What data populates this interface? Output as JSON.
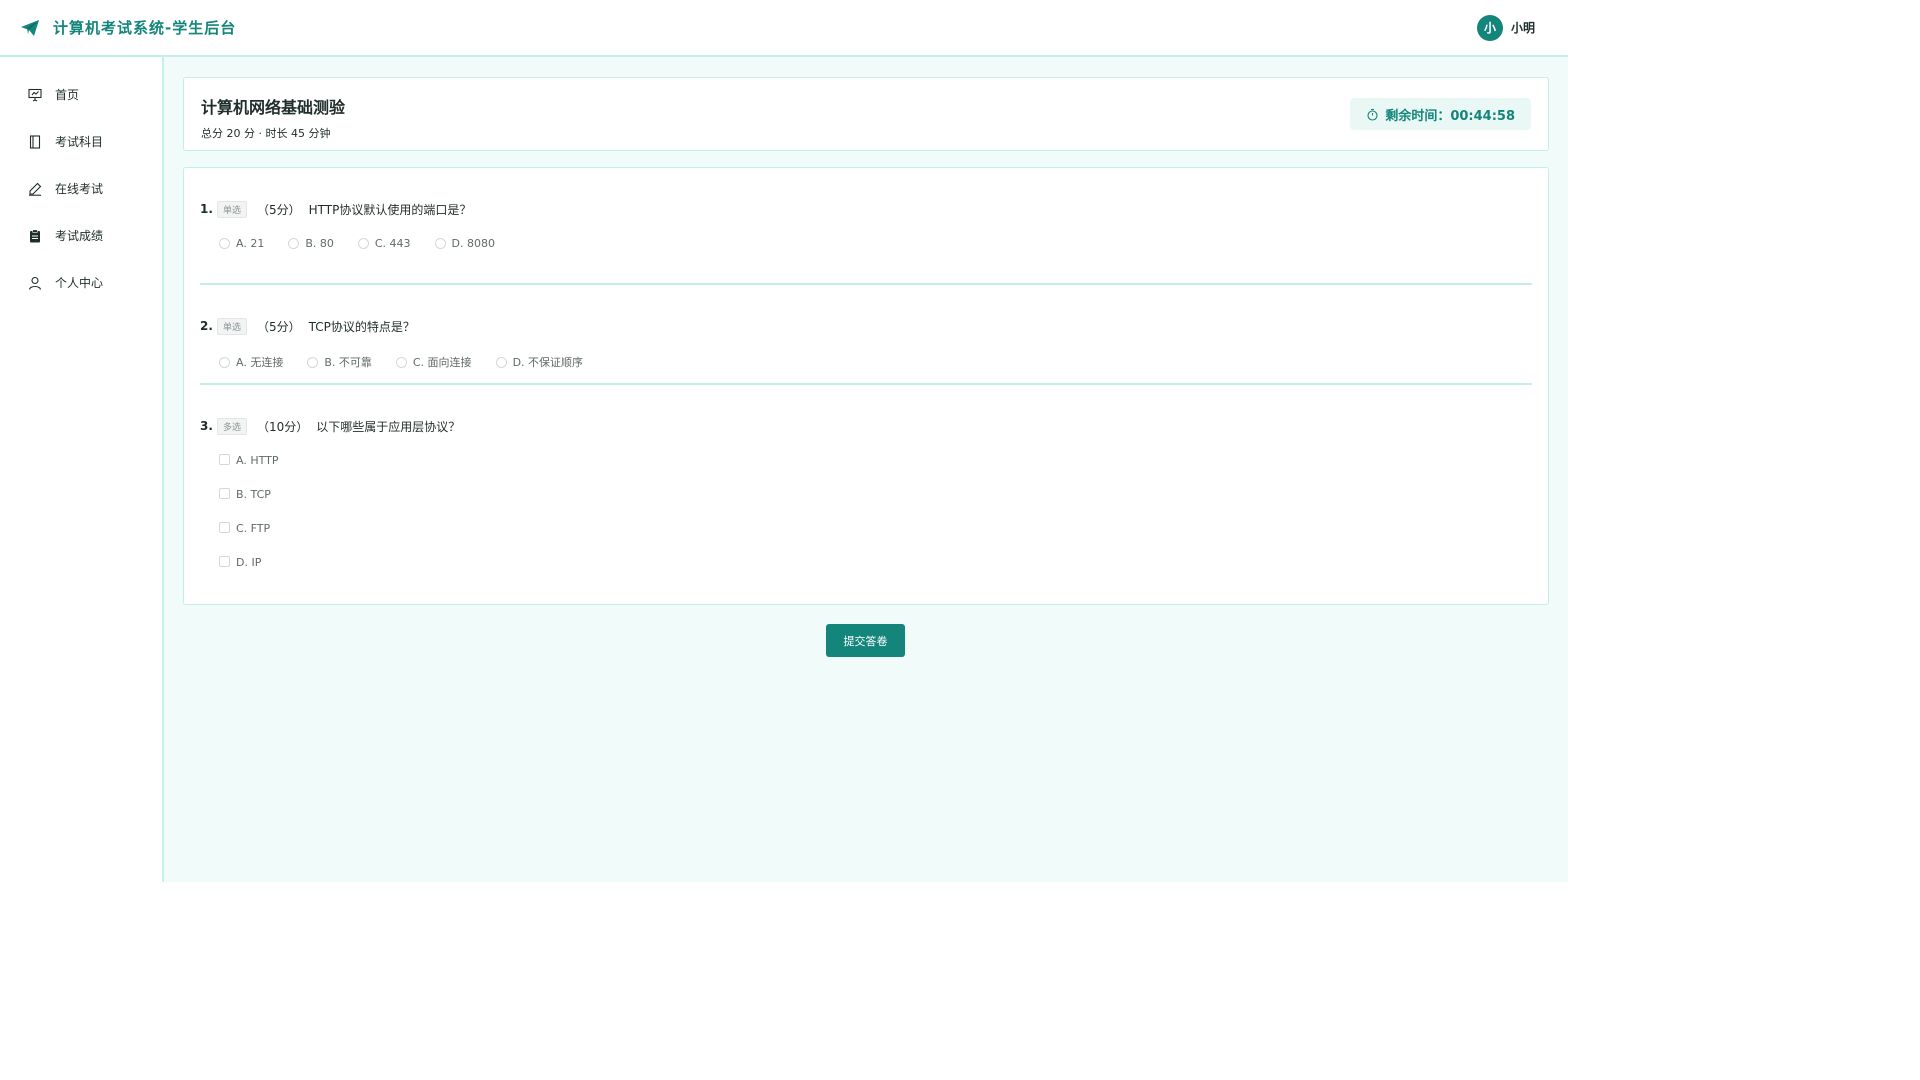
{
  "header": {
    "title": "计算机考试系统-学生后台",
    "user": {
      "avatar_text": "小",
      "name": "小明"
    }
  },
  "sidebar": {
    "items": [
      {
        "label": "首页",
        "icon": "presentation-icon"
      },
      {
        "label": "考试科目",
        "icon": "book-icon"
      },
      {
        "label": "在线考试",
        "icon": "pen-icon"
      },
      {
        "label": "考试成绩",
        "icon": "clipboard-icon"
      },
      {
        "label": "个人中心",
        "icon": "user-icon"
      }
    ]
  },
  "exam": {
    "title": "计算机网络基础测验",
    "meta": "总分 20 分 · 时长 45 分钟",
    "timer_label": "剩余时间：00:44:58"
  },
  "questions": [
    {
      "num": "1.",
      "type": "单选",
      "score": "（5分）",
      "text": "HTTP协议默认使用的端口是？",
      "options": [
        "A. 21",
        "B. 80",
        "C. 443",
        "D. 8080"
      ]
    },
    {
      "num": "2.",
      "type": "单选",
      "score": "（5分）",
      "text": "TCP协议的特点是？",
      "options": [
        "A. 无连接",
        "B. 不可靠",
        "C. 面向连接",
        "D. 不保证顺序"
      ]
    },
    {
      "num": "3.",
      "type": "多选",
      "score": "（10分）",
      "text": "以下哪些属于应用层协议？",
      "options": [
        "A. HTTP",
        "B. TCP",
        "C. FTP",
        "D. IP"
      ]
    }
  ],
  "submit_label": "提交答卷",
  "colors": {
    "accent": "#14857a",
    "border": "#c4efe7",
    "background": "#f1fbf9"
  }
}
